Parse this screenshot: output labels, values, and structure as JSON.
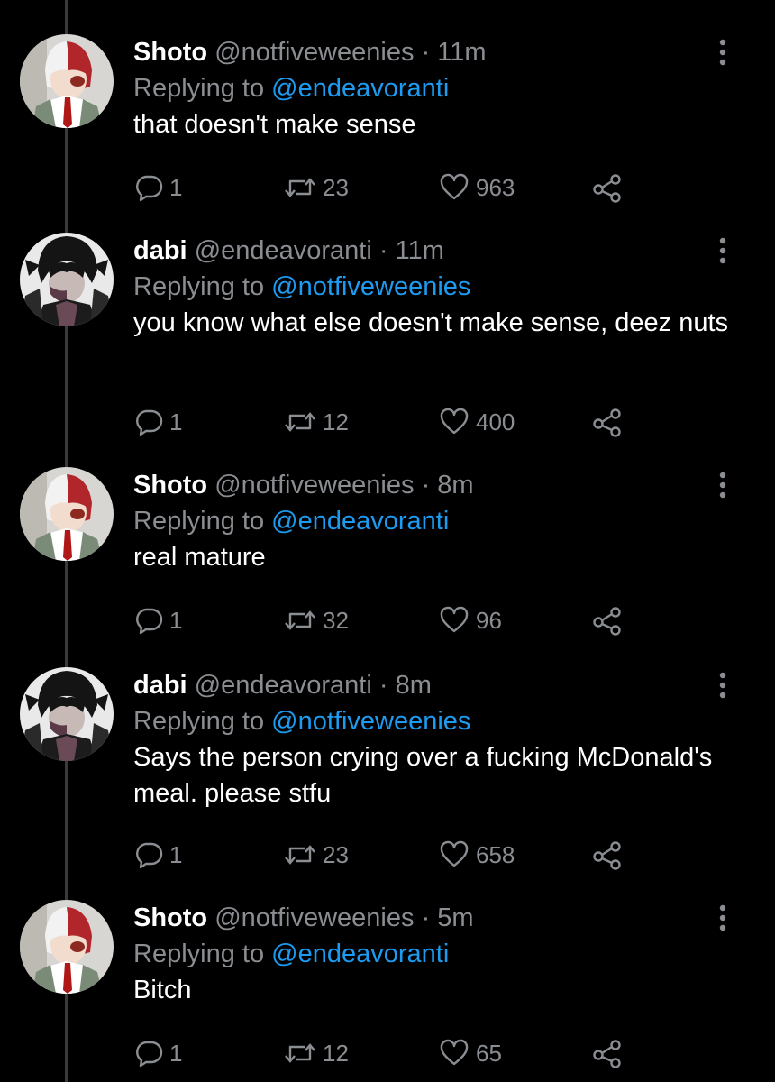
{
  "thread": [
    {
      "name": "Shoto",
      "handle": "@notfiveweenies",
      "dot": "·",
      "time": "11m",
      "replying_prefix": "Replying to",
      "replying_to": "@endeavoranti",
      "text": "that doesn't make sense",
      "replies": "1",
      "retweets": "23",
      "likes": "963",
      "avatar": "shoto-avatar"
    },
    {
      "name": "dabi",
      "handle": "@endeavoranti",
      "dot": "·",
      "time": "11m",
      "replying_prefix": "Replying to",
      "replying_to": "@notfiveweenies",
      "text": "you know what else doesn't make sense, deez nuts",
      "replies": "1",
      "retweets": "12",
      "likes": "400",
      "avatar": "dabi-avatar"
    },
    {
      "name": "Shoto",
      "handle": "@notfiveweenies",
      "dot": "·",
      "time": "8m",
      "replying_prefix": "Replying to",
      "replying_to": "@endeavoranti",
      "text": "real mature",
      "replies": "1",
      "retweets": "32",
      "likes": "96",
      "avatar": "shoto-avatar"
    },
    {
      "name": "dabi",
      "handle": "@endeavoranti",
      "dot": "·",
      "time": "8m",
      "replying_prefix": "Replying to",
      "replying_to": "@notfiveweenies",
      "text": "Says the person crying over a fucking McDonald's meal. please stfu",
      "replies": "1",
      "retweets": "23",
      "likes": "658",
      "avatar": "dabi-avatar"
    },
    {
      "name": "Shoto",
      "handle": "@notfiveweenies",
      "dot": "·",
      "time": "5m",
      "replying_prefix": "Replying to",
      "replying_to": "@endeavoranti",
      "text": "Bitch",
      "replies": "1",
      "retweets": "12",
      "likes": "65",
      "avatar": "shoto-avatar"
    }
  ],
  "colors": {
    "background": "#000000",
    "text": "#ffffff",
    "secondary": "#8a8d91",
    "mention": "#1d9bf0"
  }
}
